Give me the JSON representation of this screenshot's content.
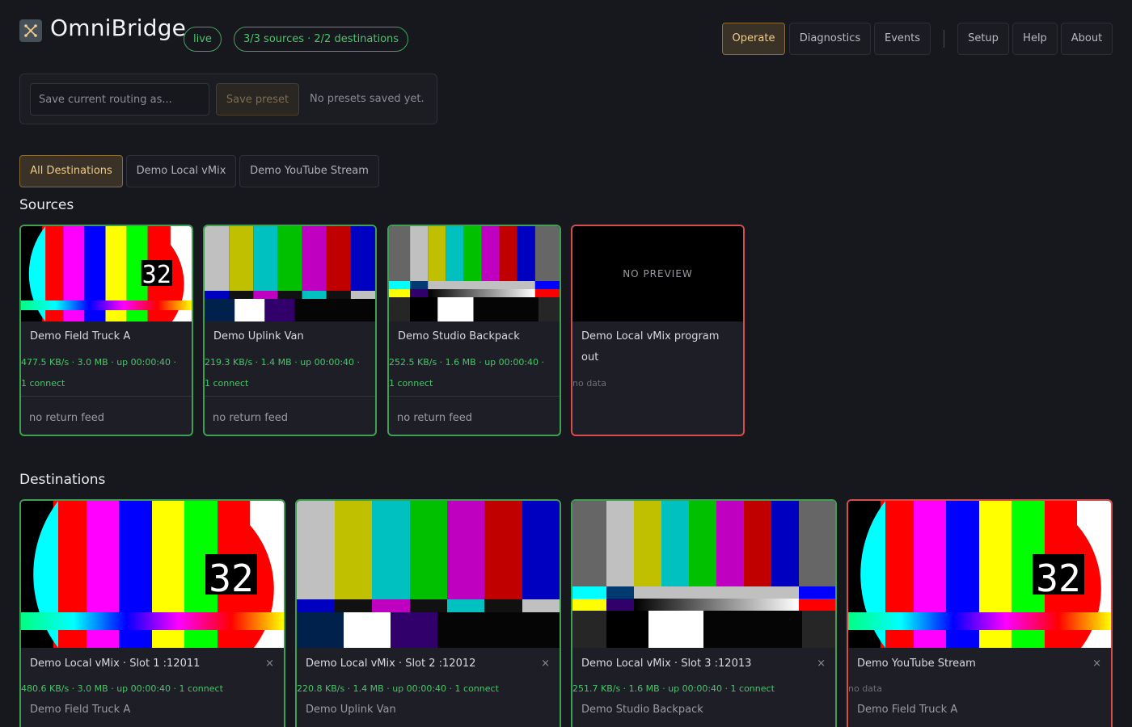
{
  "header": {
    "title": "OmniBridge",
    "status": "live",
    "summary": "3/3 sources · 2/2 destinations",
    "nav": [
      "Operate",
      "Diagnostics",
      "Events"
    ],
    "nav_secondary": [
      "Setup",
      "Help",
      "About"
    ]
  },
  "presets": {
    "placeholder": "Save current routing as...",
    "save_label": "Save preset",
    "empty_text": "No presets saved yet."
  },
  "filters": [
    "All Destinations",
    "Demo Local vMix",
    "Demo YouTube Stream"
  ],
  "sections": {
    "sources": "Sources",
    "destinations": "Destinations"
  },
  "sources": [
    {
      "name": "Demo Field Truck A",
      "stats": "477.5 KB/s · 3.0 MB · up 00:00:40 · 1 connect",
      "return": "no return feed",
      "status": "ok"
    },
    {
      "name": "Demo Uplink Van",
      "stats": "219.3 KB/s · 1.4 MB · up 00:00:40 · 1 connect",
      "return": "no return feed",
      "status": "ok"
    },
    {
      "name": "Demo Studio Backpack",
      "stats": "252.5 KB/s · 1.6 MB · up 00:00:40 · 1 connect",
      "return": "no return feed",
      "status": "ok"
    },
    {
      "name": "Demo Local vMix program out",
      "stats": "no data",
      "preview": "NO PREVIEW",
      "status": "error"
    }
  ],
  "destinations": [
    {
      "name": "Demo Local vMix · Slot 1 :12011",
      "stats": "480.6 KB/s · 3.0 MB · up 00:00:40 · 1 connect",
      "route": "Demo Field Truck A",
      "close": "×",
      "status": "ok"
    },
    {
      "name": "Demo Local vMix · Slot 2 :12012",
      "stats": "220.8 KB/s · 1.4 MB · up 00:00:40 · 1 connect",
      "route": "Demo Uplink Van",
      "close": "×",
      "status": "ok"
    },
    {
      "name": "Demo Local vMix · Slot 3 :12013",
      "stats": "251.7 KB/s · 1.6 MB · up 00:00:40 · 1 connect",
      "route": "Demo Studio Backpack",
      "close": "×",
      "status": "ok"
    },
    {
      "name": "Demo YouTube Stream",
      "stats": "no data",
      "route": "Demo Field Truck A",
      "close": "×",
      "status": "error"
    }
  ],
  "colors": {
    "ok": "#3ea055",
    "error": "#d64d4d",
    "accent": "#f0cb8a"
  },
  "icons": {
    "logo": "omnibridge-logo-icon",
    "close": "close-icon"
  }
}
